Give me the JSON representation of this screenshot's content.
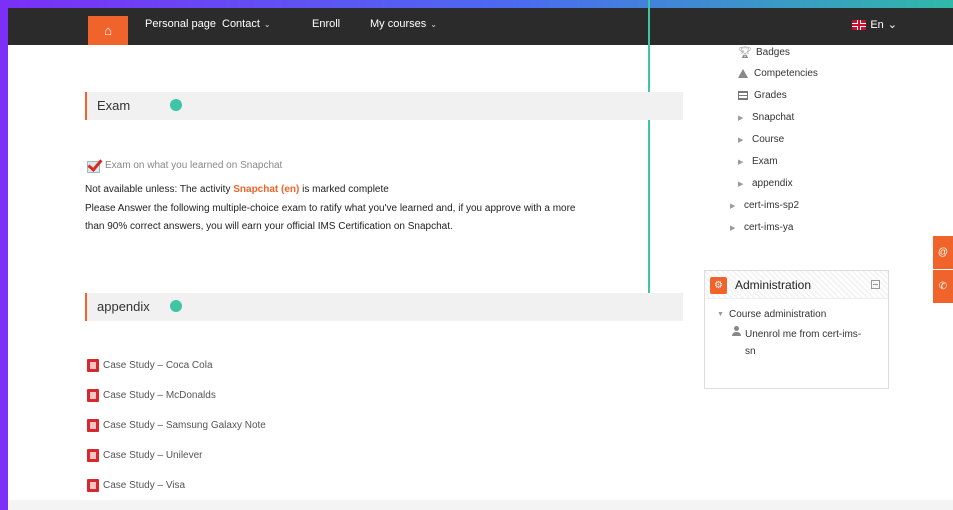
{
  "nav": {
    "home_icon": "⌂",
    "items": [
      {
        "label": "Personal page",
        "dropdown": false
      },
      {
        "label": "Contact",
        "dropdown": true
      },
      {
        "label": "Enroll",
        "dropdown": false
      },
      {
        "label": "My courses",
        "dropdown": true
      }
    ],
    "language": "En"
  },
  "sections": {
    "exam": {
      "title": "Exam",
      "activity_label": "Exam on what you learned on Snapchat",
      "restriction_prefix": "Not available unless: The activity ",
      "restriction_activity": "Snapchat (en)",
      "restriction_suffix": " is marked complete",
      "description_line1": "Please Answer the following multiple-choice exam to ratify what you've learned and, if you approve with a more",
      "description_line2": "than 90% correct answers, you will earn your official IMS Certification on Snapchat."
    },
    "appendix": {
      "title": "appendix",
      "resources": [
        "Case Study – Coca Cola",
        "Case Study – McDonalds",
        "Case Study – Samsung Galaxy Note",
        "Case Study – Unilever",
        "Case Study – Visa"
      ]
    }
  },
  "navigation_tree": {
    "items": [
      {
        "label": "Badges",
        "icon": "trophy-icon"
      },
      {
        "label": "Competencies",
        "icon": "competency-icon"
      },
      {
        "label": "Grades",
        "icon": "grades-icon"
      },
      {
        "label": "Snapchat",
        "icon": "triangle-right-icon"
      },
      {
        "label": "Course",
        "icon": "triangle-right-icon"
      },
      {
        "label": "Exam",
        "icon": "triangle-right-icon"
      },
      {
        "label": "appendix",
        "icon": "triangle-right-icon"
      },
      {
        "label": "cert-ims-sp2",
        "icon": "triangle-right-icon"
      },
      {
        "label": "cert-ims-ya",
        "icon": "triangle-right-icon"
      }
    ]
  },
  "administration": {
    "title": "Administration",
    "course_admin_label": "Course administration",
    "unenrol_line1": "Unenrol me from cert-ims-",
    "unenrol_line2": "sn"
  },
  "colors": {
    "accent": "#f0642b",
    "connector": "#3fc5a5",
    "frame": "#7b2ff7"
  }
}
